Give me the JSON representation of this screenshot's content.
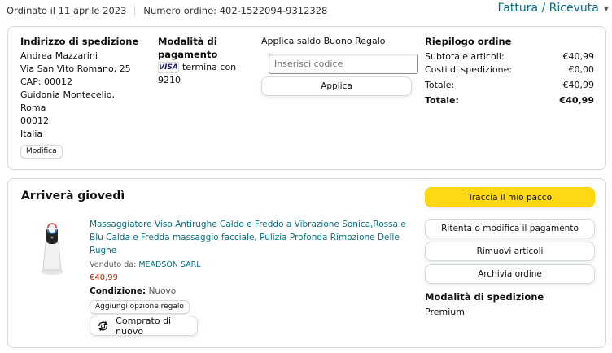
{
  "order": {
    "date_text": "Ordinato il 11 aprile 2023",
    "number_text": "Numero ordine: 402-1522094-9312328",
    "invoice_link": "Fattura / Ricevuta"
  },
  "shipping_address": {
    "heading": "Indirizzo di spedizione",
    "lines": [
      "Andrea Mazzarini",
      "Via San Vito Romano, 25",
      "CAP: 00012",
      "Guidonia Montecelio, Roma",
      "00012",
      "Italia"
    ],
    "edit_label": "Modifica"
  },
  "payment": {
    "heading_line1": "Modalità di",
    "heading_line2": "pagamento",
    "card_brand": "VISA",
    "card_text": "termina con",
    "card_last4": "9210"
  },
  "gift_card": {
    "heading": "Applica saldo Buono Regalo",
    "placeholder": "Inserisci codice",
    "apply_label": "Applica"
  },
  "summary": {
    "heading": "Riepilogo ordine",
    "rows": [
      {
        "label": "Subtotale articoli:",
        "value": "€40,99"
      },
      {
        "label": "Costi di spedizione:",
        "value": "€0,00"
      },
      {
        "label": "Totale:",
        "value": "€40,99"
      },
      {
        "label": "Totale:",
        "value": "€40,99"
      }
    ]
  },
  "shipment": {
    "arrival_text": "Arriverà giovedì",
    "product": {
      "title_line1": "Massaggiatore Viso Antirughe Caldo e Freddo a Vibrazione Sonica,Rossa e",
      "title_line2": "Blu Calda e Fredda massaggio facciale, Pulizia Profonda Rimozione Delle",
      "title_line3": "Rughe",
      "sold_by_label": "Venduto da:",
      "seller": "MEADSON SARL",
      "price": "€40,99",
      "condition_label": "Condizione:",
      "condition_value": "Nuovo",
      "gift_option_label": "Aggiungi opzione regalo",
      "buy_again_label": "Comprato di nuovo"
    },
    "actions": {
      "track": "Traccia il mio pacco",
      "retry_payment": "Ritenta o modifica il pagamento",
      "remove_items": "Rimuovi articoli",
      "archive": "Archivia ordine"
    },
    "shipping_method_heading": "Modalità di spedizione",
    "shipping_method_value": "Premium"
  },
  "colors": {
    "link": "#007185",
    "price": "#b12704",
    "track_button": "#ffd814",
    "border": "#d5d9d9"
  }
}
